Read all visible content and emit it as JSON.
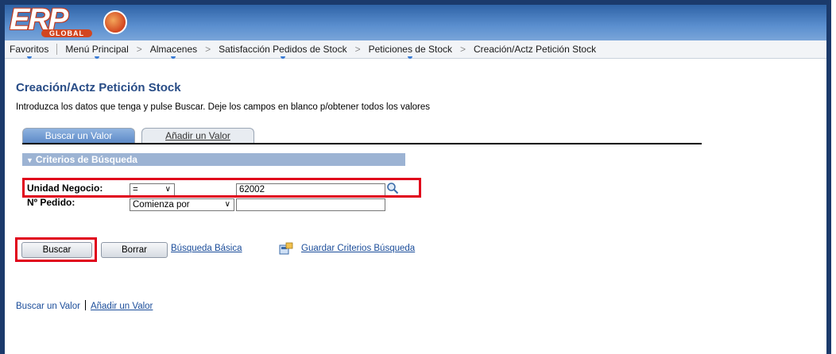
{
  "logo": {
    "text": "ERP",
    "sub": "GLOBAL"
  },
  "nav": {
    "items": [
      "Favoritos",
      "Menú Principal",
      "Almacenes",
      "Satisfacción Pedidos de Stock",
      "Peticiones de Stock",
      "Creación/Actz Petición Stock"
    ],
    "separator": ">"
  },
  "page": {
    "title": "Creación/Actz Petición Stock",
    "instructions": "Introduzca los datos que tenga y pulse Buscar. Deje los campos en blanco p/obtener todos los valores"
  },
  "tabs": [
    {
      "label": "Buscar un Valor",
      "active": true
    },
    {
      "label": "Añadir un Valor",
      "active": false
    }
  ],
  "criteria": {
    "header": "Criterios de Búsqueda",
    "unidad_label": "Unidad Negocio:",
    "unidad_operator": "=",
    "unidad_value": "62002",
    "pedido_label": "Nº Pedido:",
    "pedido_operator": "Comienza por",
    "pedido_value": ""
  },
  "actions": {
    "buscar": "Buscar",
    "borrar": "Borrar",
    "basica": "Búsqueda Básica",
    "guardar": "Guardar Criterios Búsqueda"
  },
  "bottom": {
    "buscar": "Buscar un Valor",
    "add": "Añadir un Valor"
  },
  "colors": {
    "frame": "#1b3a6b",
    "title": "#284c86",
    "highlight": "#e0001b",
    "link": "#1b4d9a"
  }
}
